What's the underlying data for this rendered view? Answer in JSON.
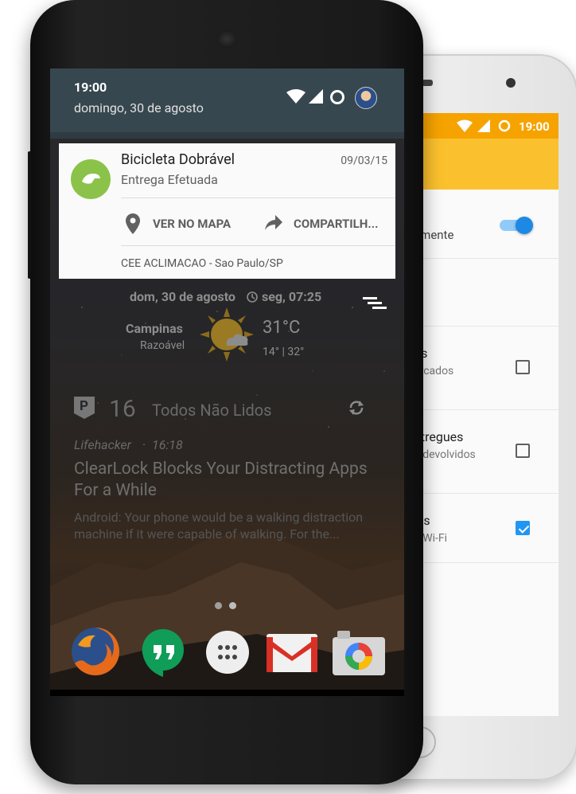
{
  "status": {
    "time": "19:00",
    "date": "domingo, 30 de agosto"
  },
  "notification": {
    "title": "Bicicleta Dobrável",
    "subtitle": "Entrega Efetuada",
    "date": "09/03/15",
    "actions": [
      {
        "label": "VER NO MAPA",
        "icon": "map-pin-icon"
      },
      {
        "label": "COMPARTILH...",
        "icon": "share-icon"
      }
    ],
    "footer": "CEE ACLIMACAO - Sao Paulo/SP"
  },
  "widget": {
    "date": "dom, 30 de agosto",
    "alarm": "seg, 07:25",
    "city": "Campinas",
    "condition": "Razoável",
    "temperature": "31°C",
    "range": "14° | 32°"
  },
  "feed": {
    "count": "16",
    "label": "Todos Não Lidos",
    "source": "Lifehacker",
    "time": "16:18",
    "headline": "ClearLock Blocks Your Distracting Apps For a While",
    "excerpt": "Android: Your phone would be a walking distraction machine if it were capable of walking. For the..."
  },
  "dock": [
    {
      "name": "firefox-icon"
    },
    {
      "name": "hangouts-icon"
    },
    {
      "name": "app-drawer-icon"
    },
    {
      "name": "gmail-icon"
    },
    {
      "name": "camera-icon"
    }
  ],
  "back_phone": {
    "status_time": "19:00",
    "rows": [
      {
        "title": "",
        "sub": "amente",
        "control": "toggle",
        "checked": true
      },
      {
        "title": "os",
        "sub": "arcados",
        "control": "checkbox",
        "checked": false
      },
      {
        "title": "ntregues",
        "sub": "u devolvidos",
        "control": "checkbox",
        "checked": false
      },
      {
        "title": "eis",
        "sub": "n Wi-Fi",
        "control": "checkbox",
        "checked": true
      }
    ]
  },
  "colors": {
    "status_orange": "#f6a300",
    "appbar_yellow": "#fbc02d",
    "accent_blue": "#2196f3",
    "notif_green": "#8bc34a",
    "shade": "#37474f"
  }
}
